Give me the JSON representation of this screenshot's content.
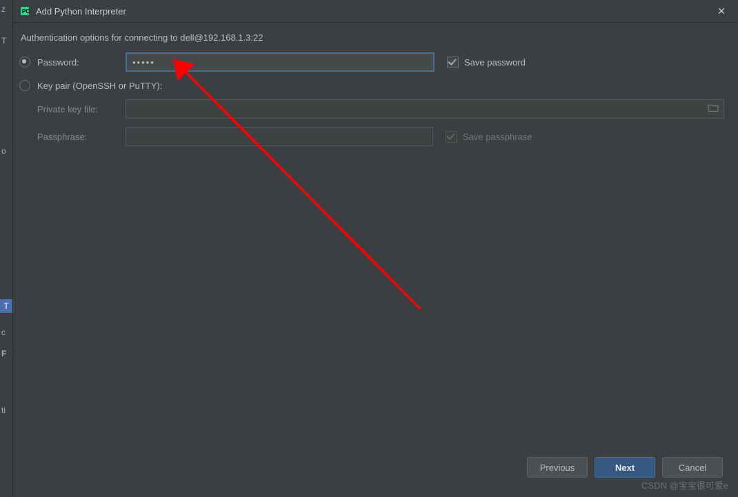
{
  "left_strip": {
    "a": "z",
    "b": "T",
    "c": "o",
    "sel": "T",
    "e": "c",
    "f": "F",
    "g": "ti"
  },
  "titlebar": {
    "title": "Add Python Interpreter",
    "close_glyph": "✕"
  },
  "auth": {
    "header": "Authentication options for connecting to dell@192.168.1.3:22",
    "password_label": "Password:",
    "password_value": "•••••",
    "save_password_label": "Save password",
    "keypair_label": "Key pair (OpenSSH or PuTTY):",
    "private_key_label": "Private key file:",
    "private_key_value": "",
    "passphrase_label": "Passphrase:",
    "passphrase_value": "",
    "save_passphrase_label": "Save passphrase"
  },
  "buttons": {
    "previous": "Previous",
    "next": "Next",
    "cancel": "Cancel"
  },
  "watermark": "CSDN @宝宝很可爱e"
}
